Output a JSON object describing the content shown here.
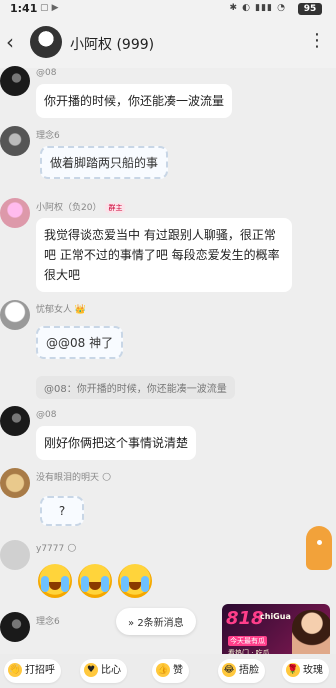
{
  "status": {
    "time": "1:41",
    "extra": "▢ ▶",
    "system": "✱ ◐ ▮▮▮ ◔",
    "battery": "95"
  },
  "header": {
    "back": "‹",
    "title": "小阿权 (999)",
    "more": "⋮"
  },
  "messages": [
    {
      "name": "@08",
      "text": "你开播的时候，你还能凑一波流量"
    },
    {
      "name": "理念6",
      "text": "做着脚踏两只船的事"
    },
    {
      "name": "小阿权（负20）",
      "badge": "群主",
      "text": "我觉得谈恋爱当中 有过跟别人聊骚，很正常吧 正常不过的事情了吧 每段恋爱发生的概率很大吧"
    },
    {
      "name": "忧郁女人",
      "badge_emoji": "👑",
      "text": "@@08 神了",
      "quote": "@08：你开播的时候，你还能凑一波流量"
    },
    {
      "name": "@08",
      "text": "刚好你俩把这个事情说清楚"
    },
    {
      "name": "没有眼泪的明天",
      "badge_emoji": "🌕",
      "text": "?"
    },
    {
      "name": "y7777",
      "badge_emoji": "🌕"
    },
    {
      "name": "理念6"
    }
  ],
  "new_messages": {
    "icon": "»",
    "text": "2条新消息"
  },
  "ad": {
    "big": "818",
    "brand": "chiGua",
    "tag": "今天最有瓜",
    "line": "看热门 · 吃瓜"
  },
  "quick_replies": [
    {
      "icon": "👋",
      "label": "打招呼"
    },
    {
      "icon": "♥",
      "label": "比心"
    },
    {
      "icon": "👍",
      "label": "赞"
    },
    {
      "icon": "😂",
      "label": "捂脸"
    },
    {
      "icon": "🌹",
      "label": "玫瑰"
    }
  ],
  "colors": {
    "background": "#eeeeee",
    "bubble": "#ffffff",
    "accent": "#f2a23a"
  }
}
